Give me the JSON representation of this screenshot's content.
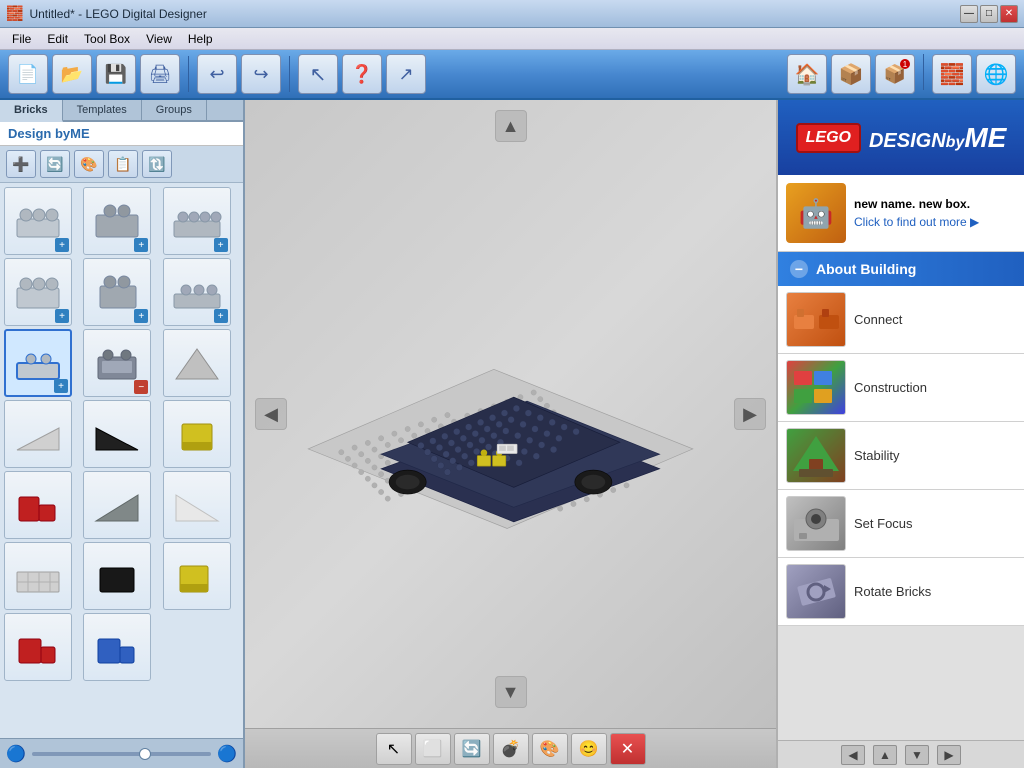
{
  "titlebar": {
    "title": "Untitled* - LEGO Digital Designer",
    "icon": "🧱",
    "buttons": {
      "minimize": "—",
      "maximize": "□",
      "close": "✕"
    }
  },
  "menubar": {
    "items": [
      "File",
      "Edit",
      "Tool Box",
      "View",
      "Help"
    ]
  },
  "toolbar": {
    "buttons": [
      "📄",
      "📂",
      "💾",
      "🖨",
      "↩",
      "↪",
      "➜",
      "❓",
      "↗"
    ]
  },
  "left_panel": {
    "tabs": [
      "Bricks",
      "Templates",
      "Groups"
    ],
    "active_tab": "Bricks",
    "design_label": "Design byME",
    "bricks": [
      {
        "color": "#c0c8d0",
        "shape": "flat",
        "has_plus": true
      },
      {
        "color": "#a0a8b0",
        "shape": "2x2",
        "has_plus": true
      },
      {
        "color": "#b0b8c0",
        "shape": "wide",
        "has_plus": true
      },
      {
        "color": "#c0c8d0",
        "shape": "flat2",
        "has_plus": true
      },
      {
        "color": "#a0a8b0",
        "shape": "corner",
        "has_plus": true
      },
      {
        "color": "#b0b8c0",
        "shape": "flat3",
        "has_plus": true
      },
      {
        "color": "#c0c8d0",
        "shape": "small",
        "has_plus": true
      },
      {
        "color": "#a0a8b0",
        "shape": "med",
        "has_plus": true
      },
      {
        "color": "#b0b8c0",
        "shape": "wide2",
        "has_plus": true
      },
      {
        "color": "#c0c8d0",
        "shape": "selected",
        "has_plus": true,
        "selected": true
      },
      {
        "color": "#808898",
        "shape": "monitor",
        "has_minus": true
      },
      {
        "color": "#b0b0b0",
        "shape": "tri",
        "has_plus": false
      },
      {
        "color": "#d0d0d0",
        "shape": "tri2",
        "has_plus": false
      },
      {
        "color": "#202020",
        "shape": "tri3",
        "has_plus": false
      },
      {
        "color": "#d0c020",
        "shape": "cup",
        "has_plus": false
      },
      {
        "color": "#c02020",
        "shape": "block",
        "has_plus": false
      },
      {
        "color": "#808888",
        "shape": "ramp",
        "has_plus": false
      },
      {
        "color": "#ffffff",
        "shape": "ramp2",
        "has_plus": false
      },
      {
        "color": "#d0d0d0",
        "shape": "panel",
        "has_plus": false
      },
      {
        "color": "#181818",
        "shape": "dark",
        "has_plus": false
      },
      {
        "color": "#d0c020",
        "shape": "cup2",
        "has_plus": false
      },
      {
        "color": "#c02020",
        "shape": "block2",
        "has_plus": false
      },
      {
        "color": "#3060c0",
        "shape": "block3",
        "has_plus": false
      }
    ]
  },
  "viewport": {
    "scene_desc": "LEGO 3D building scene with dark blue/gray car base on gray baseplate"
  },
  "bottom_toolbar": {
    "buttons": [
      {
        "icon": "↖",
        "label": "select"
      },
      {
        "icon": "⬜",
        "label": "brick-add"
      },
      {
        "icon": "🔄",
        "label": "rotate"
      },
      {
        "icon": "💣",
        "label": "delete"
      },
      {
        "icon": "🔵",
        "label": "color"
      },
      {
        "icon": "😊",
        "label": "minifig"
      },
      {
        "icon": "✕",
        "label": "close",
        "red": true
      }
    ]
  },
  "right_panel": {
    "logo": {
      "lego_text": "LEGO",
      "design_text": "DESIGN",
      "by_text": "by",
      "me_text": "ME"
    },
    "promo": {
      "title": "new name. new box.",
      "link": "Click to find out more ▶"
    },
    "about_building": {
      "header": "About Building",
      "items": [
        {
          "label": "Connect",
          "thumb_type": "connect"
        },
        {
          "label": "Construction",
          "thumb_type": "construction"
        },
        {
          "label": "Stability",
          "thumb_type": "stability"
        },
        {
          "label": "Set Focus",
          "thumb_type": "setfocus"
        },
        {
          "label": "Rotate Bricks",
          "thumb_type": "rotate"
        }
      ]
    },
    "nav_arrows": {
      "left": "◀",
      "up": "▲",
      "down": "▼",
      "right": "▶"
    }
  }
}
